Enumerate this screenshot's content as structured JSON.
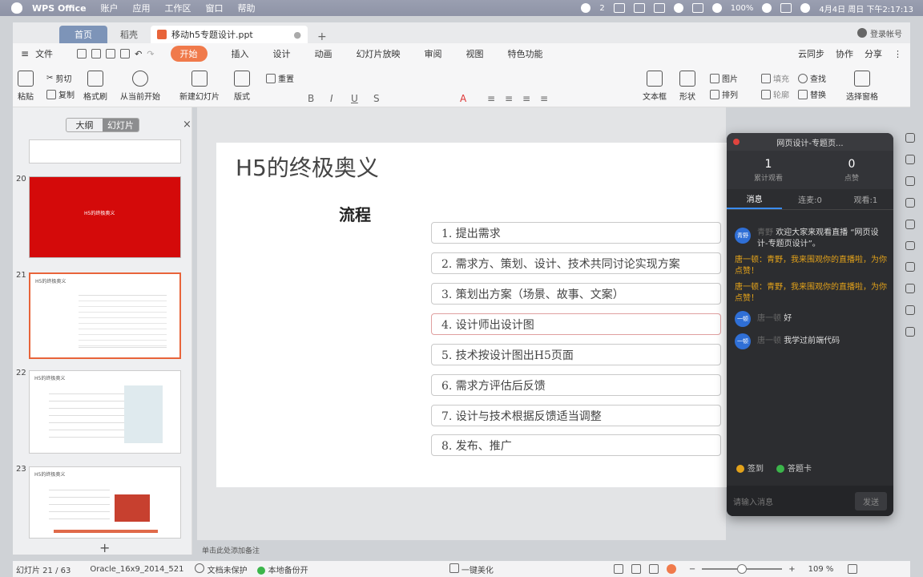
{
  "macbar": {
    "app": "WPS Office",
    "menus": [
      "账户",
      "应用",
      "工作区",
      "窗口",
      "帮助"
    ],
    "badge": "2",
    "battery": "100%",
    "clock": "4月4日 周日 下午2:17:13"
  },
  "tabs": {
    "home": "首页",
    "draft": "稻壳",
    "doc": "移动h5专题设计.ppt",
    "user": "登录帐号"
  },
  "menubar": {
    "file": "文件",
    "items": [
      "开始",
      "插入",
      "设计",
      "动画",
      "幻灯片放映",
      "审阅",
      "视图",
      "特色功能"
    ],
    "right": [
      "云同步",
      "协作",
      "分享"
    ]
  },
  "ribbon": {
    "paste": "粘贴",
    "cut": "剪切",
    "copy": "复制",
    "format_painter": "格式刷",
    "play_from_current": "从当前开始",
    "new_slide": "新建幻灯片",
    "layout": "版式",
    "reset": "重置",
    "textbox": "文本框",
    "shape": "形状",
    "picture": "图片",
    "fill": "填充",
    "arrange": "排列",
    "outline": "轮廓",
    "find": "查找",
    "replace": "替换",
    "select_pane": "选择窗格"
  },
  "leftpane": {
    "outline_tab": "大纲",
    "slides_tab": "幻灯片",
    "slides": [
      {
        "num": "20",
        "title": "H5的终极奥义"
      },
      {
        "num": "21",
        "title": "H5的终极奥义"
      },
      {
        "num": "22",
        "title": "H5的终极奥义"
      },
      {
        "num": "23",
        "title": "H5的终极奥义"
      }
    ]
  },
  "slide": {
    "title": "H5的终极奥义",
    "subtitle": "流程",
    "steps": [
      "1. 提出需求",
      "2. 需求方、策划、设计、技术共同讨论实现方案",
      "3. 策划出方案（场景、故事、文案）",
      "4. 设计师出设计图",
      "5. 技术按设计图出H5页面",
      "6. 需求方评估后反馈",
      "7. 设计与技术根据反馈适当调整",
      "8. 发布、推广"
    ]
  },
  "notes_placeholder": "单击此处添加备注",
  "live": {
    "title": "网页设计-专题页...",
    "views": "1",
    "views_label": "累计观看",
    "likes": "0",
    "likes_label": "点赞",
    "tabs": [
      "消息",
      "连麦:0",
      "观看:1"
    ],
    "messages": [
      {
        "avatar": "青野",
        "name": "青野",
        "text": "欢迎大家来观看直播 “网页设计-专题页设计”。",
        "type": "normal"
      },
      {
        "avatar": "",
        "name": "",
        "text": "唐一顿：青野，我来围观你的直播啦，为你点赞！",
        "type": "warn"
      },
      {
        "avatar": "",
        "name": "",
        "text": "唐一顿：青野，我来围观你的直播啦，为你点赞！",
        "type": "warn"
      },
      {
        "avatar": "一顿",
        "name": "唐一顿",
        "text": "好",
        "type": "normal"
      },
      {
        "avatar": "一顿",
        "name": "唐一顿",
        "text": "我学过前端代码",
        "type": "normal"
      }
    ],
    "sign_in": "签到",
    "answer_card": "答题卡",
    "input_placeholder": "请输入消息",
    "send": "发送"
  },
  "status": {
    "slide_count": "幻灯片 21 / 63",
    "theme": "Oracle_16x9_2014_521",
    "protect": "文档未保护",
    "backup": "本地备份开",
    "beautify": "一键美化",
    "zoom": "109 %"
  },
  "colors": {
    "accent": "#f07a4b",
    "live_bg": "#2c2d30",
    "slide_red": "#d40a0a",
    "warn": "#e3a21a"
  }
}
